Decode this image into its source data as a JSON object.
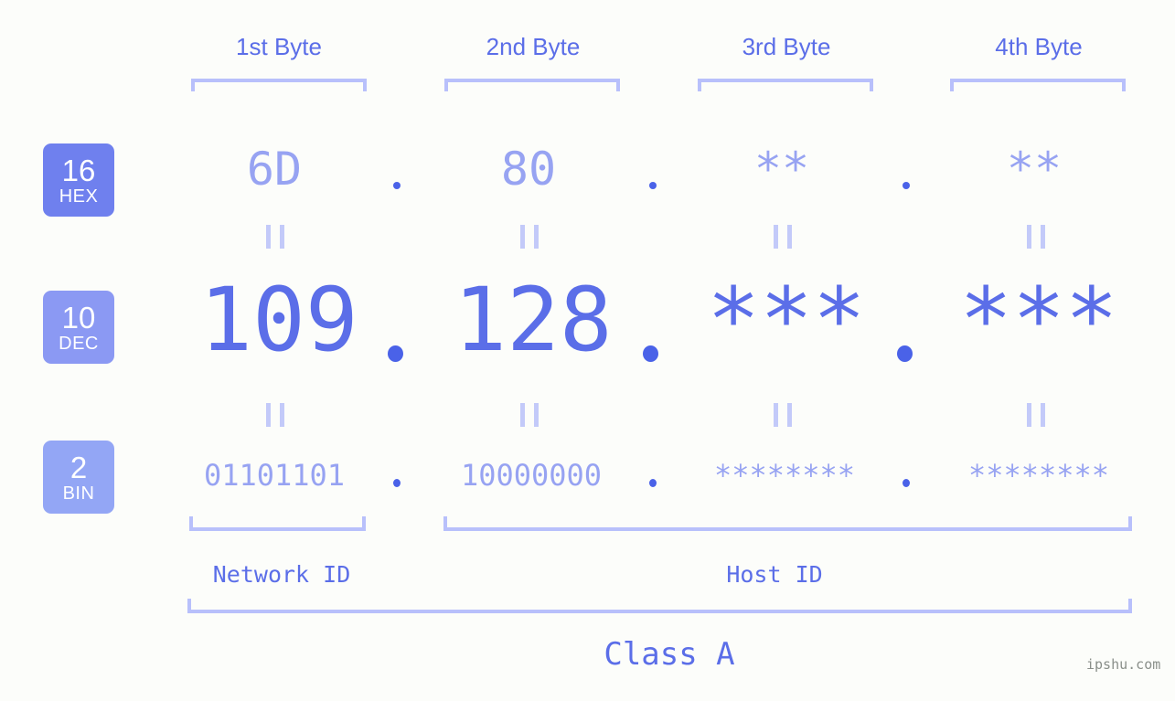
{
  "background_color": "#fcfdfa",
  "accent_color": "#5b6ee8",
  "accent_light_color": "#97a3f2",
  "bracket_color": "#b8c0fb",
  "header": {
    "bytes": [
      {
        "label": "1st Byte"
      },
      {
        "label": "2nd Byte"
      },
      {
        "label": "3rd Byte"
      },
      {
        "label": "4th Byte"
      }
    ]
  },
  "rows": [
    {
      "badge_number": "16",
      "badge_name": "HEX",
      "badge_color": "#6f80ee",
      "values": [
        "6D",
        "80",
        "**",
        "**"
      ],
      "separator": "."
    },
    {
      "badge_number": "10",
      "badge_name": "DEC",
      "badge_color": "#8b99f3",
      "values": [
        "109",
        "128",
        "***",
        "***"
      ],
      "separator": "."
    },
    {
      "badge_number": "2",
      "badge_name": "BIN",
      "badge_color": "#93a6f5",
      "values": [
        "01101101",
        "10000000",
        "********",
        "********"
      ],
      "separator": "."
    }
  ],
  "equals_marks": {
    "glyph": "||",
    "count": 8
  },
  "segments": {
    "network_id": "Network ID",
    "host_id": "Host ID"
  },
  "class": {
    "label": "Class A"
  },
  "watermark": {
    "text": "ipshu.com"
  }
}
